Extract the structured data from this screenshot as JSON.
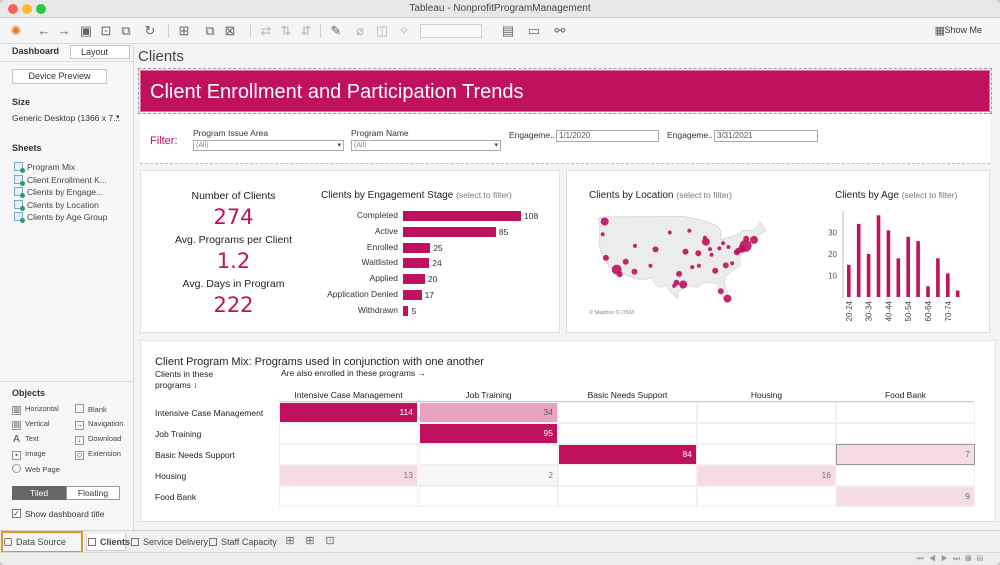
{
  "window": {
    "title": "Tableau - NonprofitProgramManagement"
  },
  "toolbar": {
    "show_me": "Show Me"
  },
  "sidebar": {
    "tabs": {
      "dashboard": "Dashboard",
      "layout": "Layout"
    },
    "device_preview": "Device Preview",
    "size_label": "Size",
    "size_value": "Generic Desktop (1366 x 7...",
    "sheets_label": "Sheets",
    "sheets": [
      "Program Mix",
      "Client Enrollment K...",
      "Clients by Engage...",
      "Clients by Location",
      "Clients by Age Group"
    ],
    "objects_label": "Objects",
    "objects": [
      "Horizontal",
      "Blank",
      "Vertical",
      "Navigation",
      "Text",
      "Download",
      "Image",
      "Extension",
      "Web Page"
    ],
    "tiled": "Tiled",
    "floating": "Floating",
    "show_title": "Show dashboard title"
  },
  "dashboard": {
    "name": "Clients",
    "banner": "Client Enrollment and Participation Trends",
    "filter_label": "Filter:",
    "filters": {
      "issue_area_title": "Program Issue Area",
      "issue_area_value": "(All)",
      "program_name_title": "Program Name",
      "program_name_value": "(All)",
      "eng_start_title": "Engageme..",
      "eng_start_value": "1/1/2020",
      "eng_end_title": "Engageme..",
      "eng_end_value": "3/31/2021"
    },
    "kpis": {
      "clients_label": "Number of Clients",
      "clients_value": "274",
      "programs_label": "Avg. Programs per Client",
      "programs_value": "1.2",
      "days_label": "Avg. Days in Program",
      "days_value": "222"
    },
    "engagement_title": "Clients by Engagement Stage",
    "location_title": "Clients by Location",
    "age_title": "Clients by Age",
    "select_hint": "(select to filter)",
    "map_credit": "© Mapbox © OSM",
    "mix_title": "Client Program Mix: Programs used in conjunction with one another",
    "mix_row_header": "Clients in these programs ↓",
    "mix_col_header": "Are also enrolled in these programs →"
  },
  "tabs": [
    "Data Source",
    "Clients",
    "Service Delivery",
    "Staff Capacity"
  ],
  "colors": {
    "accent": "#c0115f",
    "accent_light": "#e8a3c2",
    "accent_pale": "#f4dbe6"
  },
  "chart_data": [
    {
      "type": "bar",
      "title": "Clients by Engagement Stage",
      "categories": [
        "Completed",
        "Active",
        "Enrolled",
        "Waitlisted",
        "Applied",
        "Application Denied",
        "Withdrawn"
      ],
      "values": [
        108,
        85,
        25,
        24,
        20,
        17,
        5
      ]
    },
    {
      "type": "bar",
      "title": "Clients by Age",
      "categories": [
        "20-24",
        "25-29",
        "30-34",
        "35-39",
        "40-44",
        "45-49",
        "50-54",
        "55-59",
        "60-64",
        "65-69",
        "70-74",
        "75-79"
      ],
      "tick_labels": [
        "20-24",
        "30-34",
        "40-44",
        "50-54",
        "60-64",
        "70-74"
      ],
      "values": [
        15,
        34,
        20,
        38,
        31,
        18,
        28,
        26,
        5,
        18,
        11,
        3
      ],
      "yticks": [
        10,
        20,
        30
      ],
      "ylim": [
        0,
        40
      ]
    },
    {
      "type": "scatter",
      "title": "Clients by Location",
      "x": [
        -122.3,
        -121.9,
        -118.2,
        -117.2,
        -112.1,
        -111.9,
        -104.9,
        -97.7,
        -95.4,
        -96.8,
        -93.3,
        -90.2,
        -87.6,
        -86.2,
        -84.4,
        -83.0,
        -81.7,
        -80.8,
        -80.2,
        -77.0,
        -76.6,
        -75.2,
        -74.0,
        -73.8,
        -71.1,
        -82.5,
        -85.7,
        -90.0,
        -94.6,
        -98.5,
        -100.0,
        -106.6,
        -115.1,
        -123.0,
        -78.6,
        -88.0,
        -92.3,
        -79.9
      ],
      "y": [
        47.6,
        37.3,
        34.0,
        32.7,
        33.4,
        40.7,
        39.7,
        30.3,
        29.8,
        32.8,
        45.0,
        38.6,
        41.9,
        39.8,
        33.7,
        40.0,
        41.5,
        35.2,
        25.8,
        38.9,
        39.3,
        39.9,
        40.7,
        42.7,
        42.4,
        27.9,
        38.2,
        35.1,
        39.1,
        29.4,
        44.5,
        35.1,
        36.2,
        44.0,
        35.8,
        43.0,
        34.7,
        40.4
      ],
      "sizes": [
        4,
        3,
        5,
        3,
        3,
        2,
        3,
        3,
        4,
        3,
        2,
        3,
        4,
        2,
        3,
        2,
        2,
        3,
        4,
        3,
        3,
        4,
        6,
        3,
        4,
        3,
        2,
        2,
        3,
        2,
        2,
        2,
        3,
        2,
        2,
        2,
        2,
        2
      ]
    },
    {
      "type": "heatmap",
      "title": "Client Program Mix: Programs used in conjunction with one another",
      "rows": [
        "Intensive Case Management",
        "Job Training",
        "Basic Needs Support",
        "Housing",
        "Food Bank"
      ],
      "columns": [
        "Intensive Case Management",
        "Job Training",
        "Basic Needs Support",
        "Housing",
        "Food Bank"
      ],
      "cells": [
        [
          114,
          34,
          null,
          null,
          null
        ],
        [
          null,
          95,
          null,
          null,
          null
        ],
        [
          null,
          null,
          84,
          null,
          7
        ],
        [
          13,
          2,
          null,
          16,
          null
        ],
        [
          null,
          null,
          null,
          null,
          9
        ]
      ]
    }
  ]
}
